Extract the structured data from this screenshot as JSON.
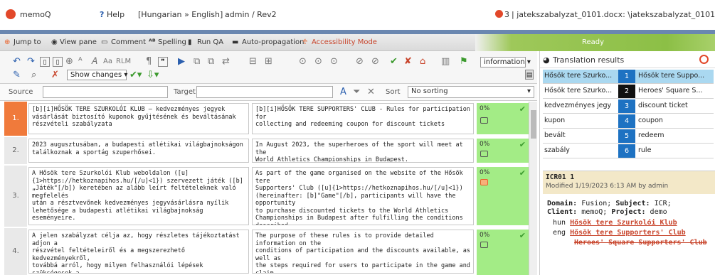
{
  "titlebar": {
    "app_name": "memoQ",
    "help_label": "Help",
    "language_label": "[Hungarian » English]",
    "user_label": "admin / Rev2",
    "doc_count": "3",
    "document_label": "| jatekszabalyzat_0101.docx: \\jatekszabalyzat_0101"
  },
  "ribbon": {
    "items": [
      "Jump to",
      "View pane",
      "Comment",
      "Spelling",
      "Run QA",
      "Auto-propagation",
      "Accessibility Mode"
    ],
    "status": "Ready"
  },
  "toolbar": {
    "show_changes": "Show changes",
    "info_select": "information",
    "rlm": "RLM",
    "aa": "Aa"
  },
  "filter": {
    "source_label": "Source",
    "target_label": "Target",
    "sort_label": "Sort",
    "sort_value": "No sorting"
  },
  "segments": [
    {
      "num": "1.",
      "src": "[b][i]HŐSÖK TERE SZURKOLÓI KLUB – kedvezményes jegyek\nvásárlását biztosító kuponok gyűjtésének és beváltásának\nrészvételi szabályzata",
      "tgt": "[b][i]HŐSÖK TERE SUPPORTERS' CLUB - Rules for participation for\ncollecting and redeeming coupon for discount tickets",
      "pct": "0%"
    },
    {
      "num": "2.",
      "src": "2023 augusztusában, a budapesti atlétikai világbajnokságon\ntalálkoznak a sportág szuperhősei.",
      "tgt": "In August 2023, the superheroes of the sport will meet at the\nWorld Athletics Championships in Budapest.",
      "pct": "0%"
    },
    {
      "num": "3.",
      "src": "A Hősök tere Szurkolói Klub weboldalon ([u]\n{1>https://hetkoznapihos.hu/[/u]<1}) szervezett játék ([b]\n„Játék\"[/b]) keretében az alább leírt feltételeknek való megfelelés\nután a résztvevőnek kedvezményes jegyvásárlásra nyílik\nlehetősége a budapesti atlétikai világbajnokság eseményeire.",
      "tgt": "As part of the game organised on the website of the Hősök tere\nSupporters' Club ([u]{1>https://hetkoznapihos.hu/[/u]<1})\n(hereinafter: [b]\"Game\"[/b], participants will have the opportunity\nto purchase discounted tickets to the World Athletics\nChampionships in Budapest after fulfilling the conditions described\nbelow.",
      "pct": "0%"
    },
    {
      "num": "4.",
      "src": "A jelen szabályzat célja az, hogy részletes tájékoztatást adjon a\nrészvétel feltételeiről és a megszerezhető kedvezményekről,\ntovábbá arról, hogy milyen felhasználói lépések szükségesek a\nrészvételhez és a kedvezmények érvényesítéséhez.",
      "tgt": "The purpose of these rules is to provide detailed information on the\nconditions of participation and the discounts available, as well as\nthe steps required for users to participate in the game and claim\ndiscounts.",
      "pct": "0%"
    }
  ],
  "translation_results": {
    "title": "Translation results",
    "rows": [
      {
        "src": "Hősök tere Szurko...",
        "num": "1",
        "tgt": "Hősök tere Suppo..."
      },
      {
        "src": "Hősök tere Szurko...",
        "num": "2",
        "tgt": "Heroes' Square S..."
      },
      {
        "src": "kedvezményes jegy",
        "num": "3",
        "tgt": "discount ticket"
      },
      {
        "src": "kupon",
        "num": "4",
        "tgt": "coupon"
      },
      {
        "src": "bevált",
        "num": "5",
        "tgt": "redeem"
      },
      {
        "src": "szabály",
        "num": "6",
        "tgt": "rule"
      }
    ]
  },
  "entry": {
    "id": "ICR01 1",
    "modified": "Modified 1/19/2023 6:13 AM by admin",
    "domain_label": "Domain:",
    "domain": "Fusion;",
    "subject_label": "Subject:",
    "subject": "ICR;",
    "client_label": "Client:",
    "client": "memoQ;",
    "project_label": "Project:",
    "project": "demo",
    "hun_label": "hun",
    "hun_term": "Hősök tere Szurkolói Klub",
    "eng_label": "eng",
    "eng_term": "Hősök tere Supporters' Club",
    "eng_term_forbidden": "Heroes' Square Supporters' Club"
  },
  "colors": {
    "accent": "#f07a3b",
    "status_green": "#a3ec86",
    "result_blue": "#1e72c2",
    "ready_green": "#8cbf46"
  }
}
